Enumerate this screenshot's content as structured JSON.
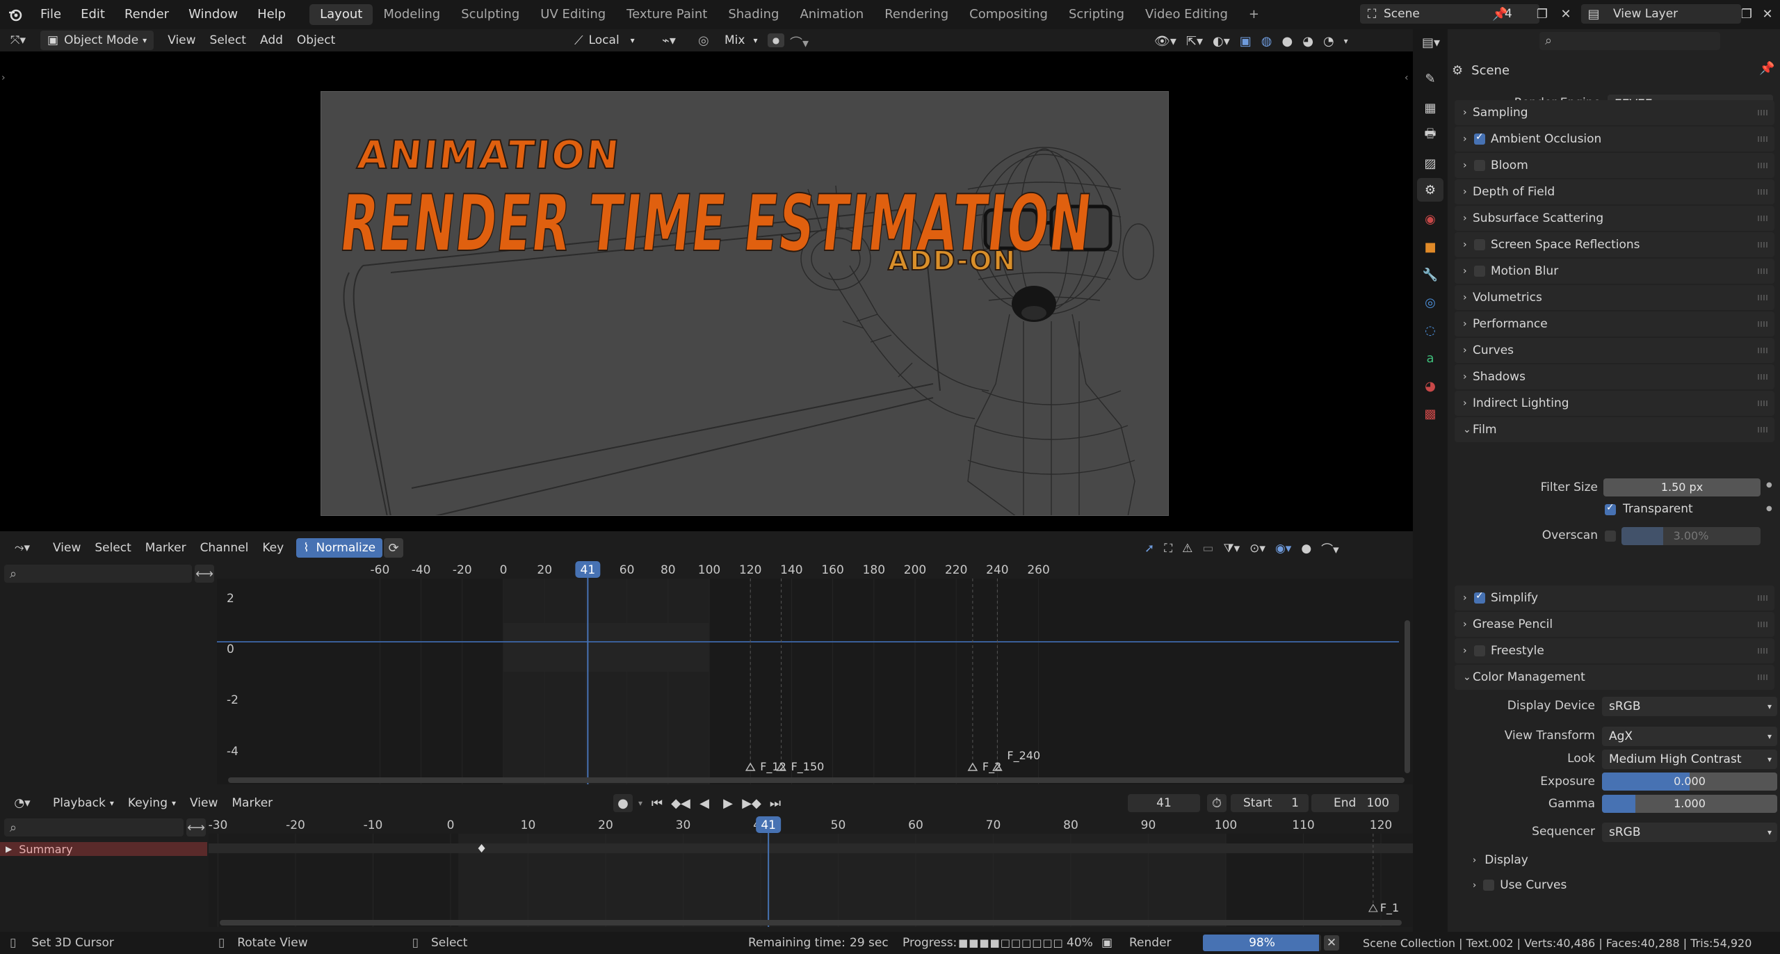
{
  "topbar": {
    "menus": [
      "File",
      "Edit",
      "Render",
      "Window",
      "Help"
    ],
    "workspaces": [
      "Layout",
      "Modeling",
      "Sculpting",
      "UV Editing",
      "Texture Paint",
      "Shading",
      "Animation",
      "Rendering",
      "Compositing",
      "Scripting",
      "Video Editing"
    ],
    "active_workspace": "Layout",
    "add_tab": "+",
    "scene_name": "Scene",
    "scene_users": "4",
    "view_layer": "View Layer"
  },
  "viewport_header": {
    "mode": "Object Mode",
    "menus": [
      "View",
      "Select",
      "Add",
      "Object"
    ],
    "transform_orientation": "Local",
    "blend": "Mix"
  },
  "viewport": {
    "overlay_title_small": "ANIMATION",
    "overlay_title_big": "RENDER TIME ESTIMATION",
    "overlay_title_addon": "ADD-ON"
  },
  "graph_editor": {
    "menus": [
      "View",
      "Select",
      "Marker",
      "Channel",
      "Key"
    ],
    "normalize": "Normalize",
    "current_frame": "41",
    "x_ticks": [
      "-60",
      "-40",
      "-20",
      "0",
      "20",
      "40",
      "60",
      "80",
      "100",
      "120",
      "140",
      "160",
      "180",
      "200",
      "220",
      "240",
      "260"
    ],
    "y_ticks": [
      "2",
      "0",
      "-2",
      "-4"
    ],
    "markers": [
      "F_12",
      "F_150",
      "F_2",
      "F_240"
    ]
  },
  "timeline": {
    "menus": [
      "Playback",
      "Keying",
      "View",
      "Marker"
    ],
    "current_frame": "41",
    "start_label": "Start",
    "start": "1",
    "end_label": "End",
    "end": "100",
    "x_ticks": [
      "-30",
      "-20",
      "-10",
      "0",
      "10",
      "20",
      "30",
      "40",
      "50",
      "60",
      "70",
      "80",
      "90",
      "100",
      "110",
      "120"
    ],
    "summary": "Summary",
    "marker": "F_1"
  },
  "properties": {
    "header": "Scene",
    "render_engine_label": "Render Engine",
    "render_engine": "EEVEE",
    "panels": [
      {
        "label": "Sampling",
        "check": null
      },
      {
        "label": "Ambient Occlusion",
        "check": true
      },
      {
        "label": "Bloom",
        "check": false
      },
      {
        "label": "Depth of Field",
        "check": null
      },
      {
        "label": "Subsurface Scattering",
        "check": null
      },
      {
        "label": "Screen Space Reflections",
        "check": false
      },
      {
        "label": "Motion Blur",
        "check": false
      },
      {
        "label": "Volumetrics",
        "check": null
      },
      {
        "label": "Performance",
        "check": null
      },
      {
        "label": "Curves",
        "check": null
      },
      {
        "label": "Shadows",
        "check": null
      },
      {
        "label": "Indirect Lighting",
        "check": null
      },
      {
        "label": "Film",
        "check": null
      }
    ],
    "film": {
      "filter_size_label": "Filter Size",
      "filter_size": "1.50 px",
      "transparent": "Transparent",
      "overscan_label": "Overscan",
      "overscan": "3.00%"
    },
    "panels2": [
      {
        "label": "Simplify",
        "check": true
      },
      {
        "label": "Grease Pencil",
        "check": null
      },
      {
        "label": "Freestyle",
        "check": false
      },
      {
        "label": "Color Management",
        "check": null
      }
    ],
    "color_management": {
      "display_device_label": "Display Device",
      "display_device": "sRGB",
      "view_transform_label": "View Transform",
      "view_transform": "AgX",
      "look_label": "Look",
      "look": "Medium High Contrast",
      "exposure_label": "Exposure",
      "exposure": "0.000",
      "gamma_label": "Gamma",
      "gamma": "1.000",
      "sequencer_label": "Sequencer",
      "sequencer": "sRGB",
      "display": "Display",
      "use_curves": "Use Curves"
    }
  },
  "status": {
    "hint1": "Set 3D Cursor",
    "hint2": "Rotate View",
    "hint3": "Select",
    "remaining_label": "Remaining time:",
    "remaining": "29 sec",
    "progress_label": "Progress:",
    "progress_bar": "■■■■□□□□□□",
    "progress_pct": "40%",
    "render_label": "Render",
    "render_pct": "98%",
    "render_fraction": 0.98,
    "stats": "Scene Collection | Text.002 | Verts:40,486 | Faces:40,288 | Tris:54,920"
  },
  "colors": {
    "accent": "#4772b3",
    "title_orange": "#e0600f",
    "summary_red": "#5a2a2a"
  }
}
